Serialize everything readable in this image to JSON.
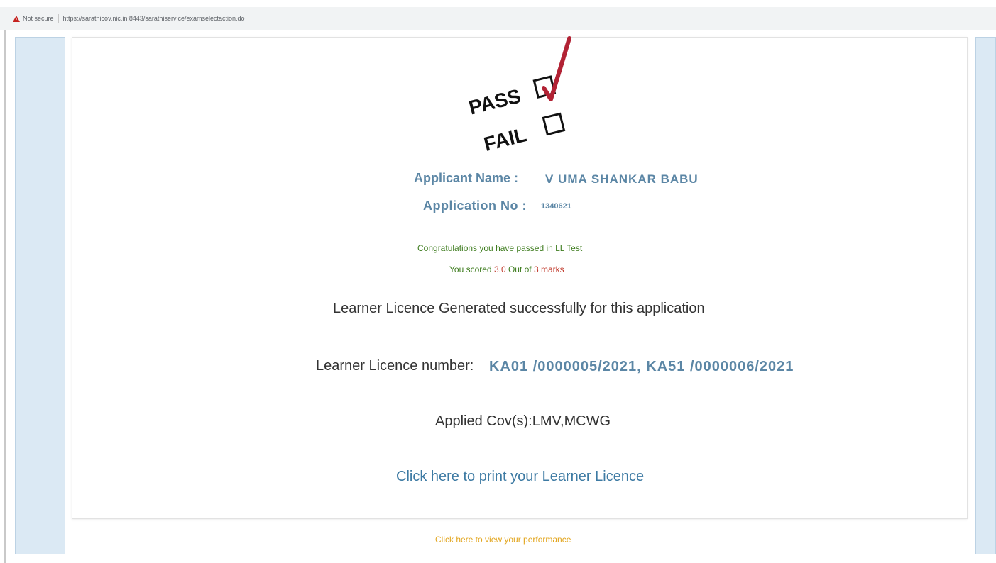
{
  "browser": {
    "security_text": "Not secure",
    "url": "https://sarathicov.nic.in:8443/sarathiservice/examselectaction.do"
  },
  "result_graphic": {
    "pass_label": "PASS",
    "fail_label": "FAIL",
    "pass_checked": true,
    "fail_checked": false
  },
  "applicant": {
    "name_label": "Applicant Name :",
    "name_value": "V UMA SHANKAR BABU",
    "appno_label": "Application No :",
    "appno_value": "1340621"
  },
  "result": {
    "congrats": "Congratulations you have passed in LL Test",
    "score_prefix": "You scored ",
    "score_value": "3.0",
    "score_mid": " Out of ",
    "score_total": "3 marks"
  },
  "licence": {
    "generated_text": "Learner Licence Generated successfully for this application",
    "number_label": "Learner Licence number:",
    "number_value": "KA01 /0000005/2021, KA51 /0000006/2021",
    "cov_text": "Applied Cov(s):LMV,MCWG"
  },
  "links": {
    "print": "Click here to print your Learner Licence",
    "performance": "Click here to view your performance"
  },
  "colors": {
    "accent_blue": "#5b86a5",
    "link_blue": "#3d7aa3",
    "success_green": "#3f7d20",
    "score_red": "#c0392b",
    "perf_orange": "#e2a51d",
    "check_red": "#b22234"
  }
}
